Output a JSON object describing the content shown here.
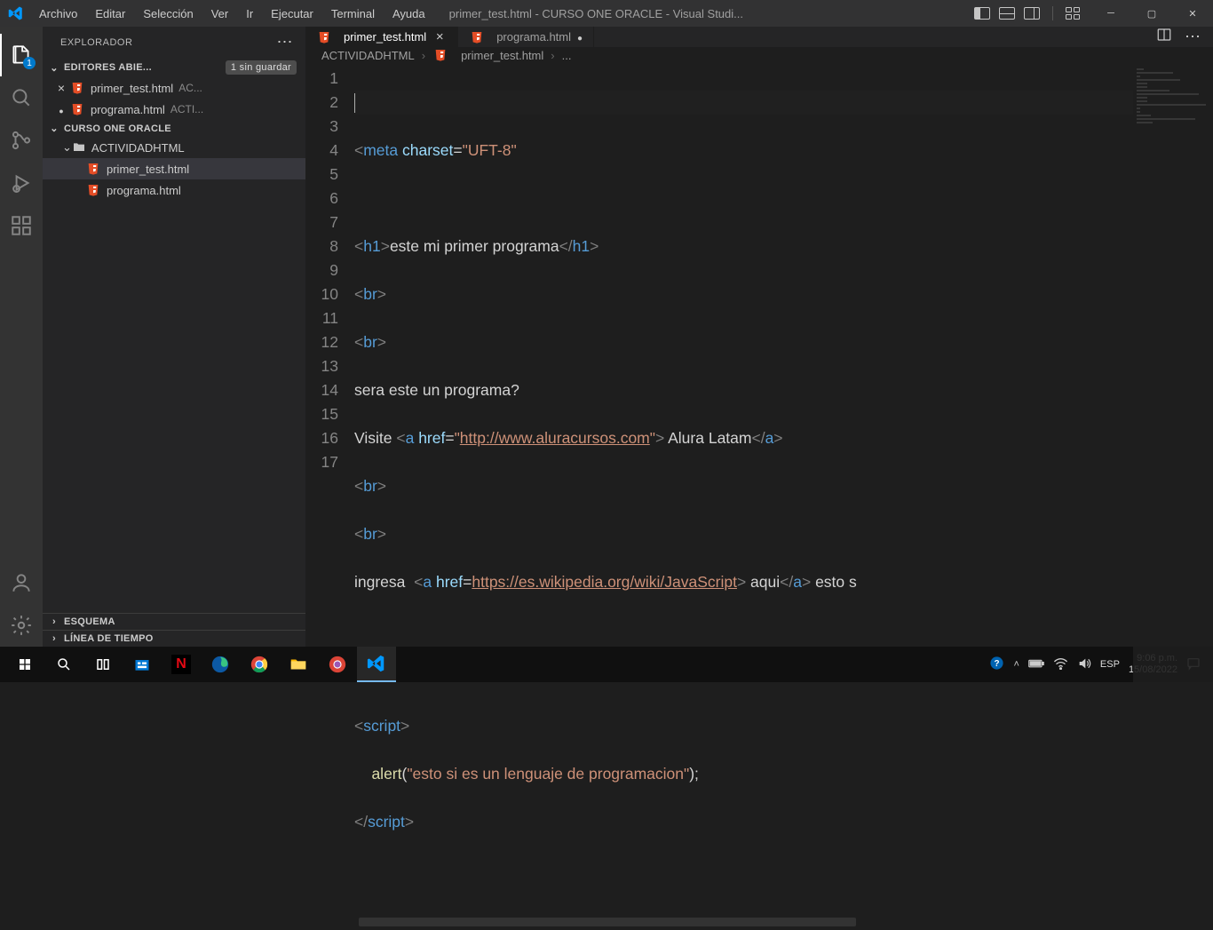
{
  "titlebar": {
    "menus": [
      "Archivo",
      "Editar",
      "Selección",
      "Ver",
      "Ir",
      "Ejecutar",
      "Terminal",
      "Ayuda"
    ],
    "title": "primer_test.html - CURSO ONE ORACLE - Visual Studi..."
  },
  "activity": {
    "explorer_badge": "1"
  },
  "sidebar": {
    "title": "EXPLORADOR",
    "openEditors": {
      "label": "EDITORES ABIE...",
      "badge": "1 sin guardar"
    },
    "openFiles": [
      {
        "name": "primer_test.html",
        "dir": "AC...",
        "close": true
      },
      {
        "name": "programa.html",
        "dir": "ACTI...",
        "dirty": true
      }
    ],
    "workspace": "CURSO ONE ORACLE",
    "folder": "ACTIVIDADHTML",
    "files": [
      {
        "name": "primer_test.html",
        "selected": true
      },
      {
        "name": "programa.html"
      }
    ],
    "outline": "ESQUEMA",
    "timeline": "LÍNEA DE TIEMPO"
  },
  "tabs": [
    {
      "name": "primer_test.html",
      "active": true,
      "close": true
    },
    {
      "name": "programa.html",
      "dirty": true
    }
  ],
  "breadcrumbs": {
    "folder": "ACTIVIDADHTML",
    "file": "primer_test.html",
    "more": "..."
  },
  "code": {
    "lines": 17,
    "l2": {
      "tag": "meta",
      "attr": "charset",
      "val": "\"UFT-8\""
    },
    "l4": {
      "tag": "h1",
      "text": "este mi primer programa"
    },
    "br": "br",
    "l7": "sera este un programa?",
    "l8": {
      "pre": "Visite ",
      "tag": "a",
      "attr": "href",
      "url": "http://www.aluracursos.com",
      "text": " Alura Latam"
    },
    "l11": {
      "pre": "ingresa  ",
      "tag": "a",
      "attr": "href",
      "url": "https://es.wikipedia.org/wiki/JavaScript",
      "text": " aqui",
      "tail": " esto s"
    },
    "l14": {
      "tag": "script"
    },
    "l15": {
      "fn": "alert",
      "str": "\"esto si es un lenguaje de programacion\""
    },
    "l16": {
      "tag": "script"
    }
  },
  "taskbar": {
    "lang": "ESP",
    "time": "9:06 p.m.",
    "date": "15/08/2022"
  }
}
